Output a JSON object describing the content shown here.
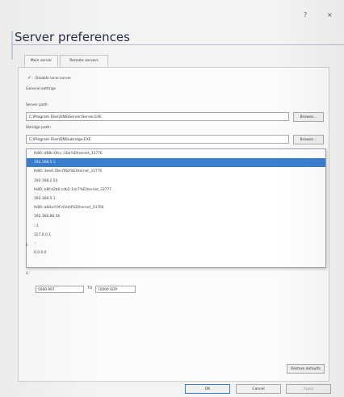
{
  "window": {
    "help_glyph": "?",
    "close_glyph": "×",
    "title": "Server preferences"
  },
  "tabs": [
    {
      "label": "Main server"
    },
    {
      "label": "Remote servers"
    }
  ],
  "disable_local": {
    "label": "Disable local server",
    "checked": true
  },
  "general_section": "General settings",
  "server_path": {
    "label": "Server path:",
    "value": "C:\\Program Files\\DNS\\Server\\Server.EXE",
    "browse": "Browse..."
  },
  "ubridge_path": {
    "label": "Ubridge path:",
    "value": "C:\\Program Files\\DNS\\ubridge.EXE",
    "browse": "Browse..."
  },
  "host_dropdown": {
    "options": [
      "fe80::d68c:0fcc::1ba%Ethernet_33776",
      "192.168.5.1",
      "fe80::3ee4:78e:f0b0%Ethernet_33776",
      "192.168.2.53",
      "fe80::e8f:d2b6:cdb2:1dc7%Ethernet_33777",
      "192.168.5.1",
      "fe80::a84a:f:0f:c0ed4%Ethernet_33768",
      "192.168.88.56",
      "::1",
      "127.0.0.1",
      "::",
      "0.0.0.0"
    ],
    "selected_index": 1
  },
  "hidden_labels": {
    "e_letter": "E",
    "u_letter": "U"
  },
  "port_range": {
    "start": "5000 997",
    "to_glyph": "TO",
    "end": "10000 UDP"
  },
  "buttons": {
    "restore": "Restore defaults",
    "ok": "OK",
    "cancel": "Cancel",
    "apply": "Apply"
  }
}
